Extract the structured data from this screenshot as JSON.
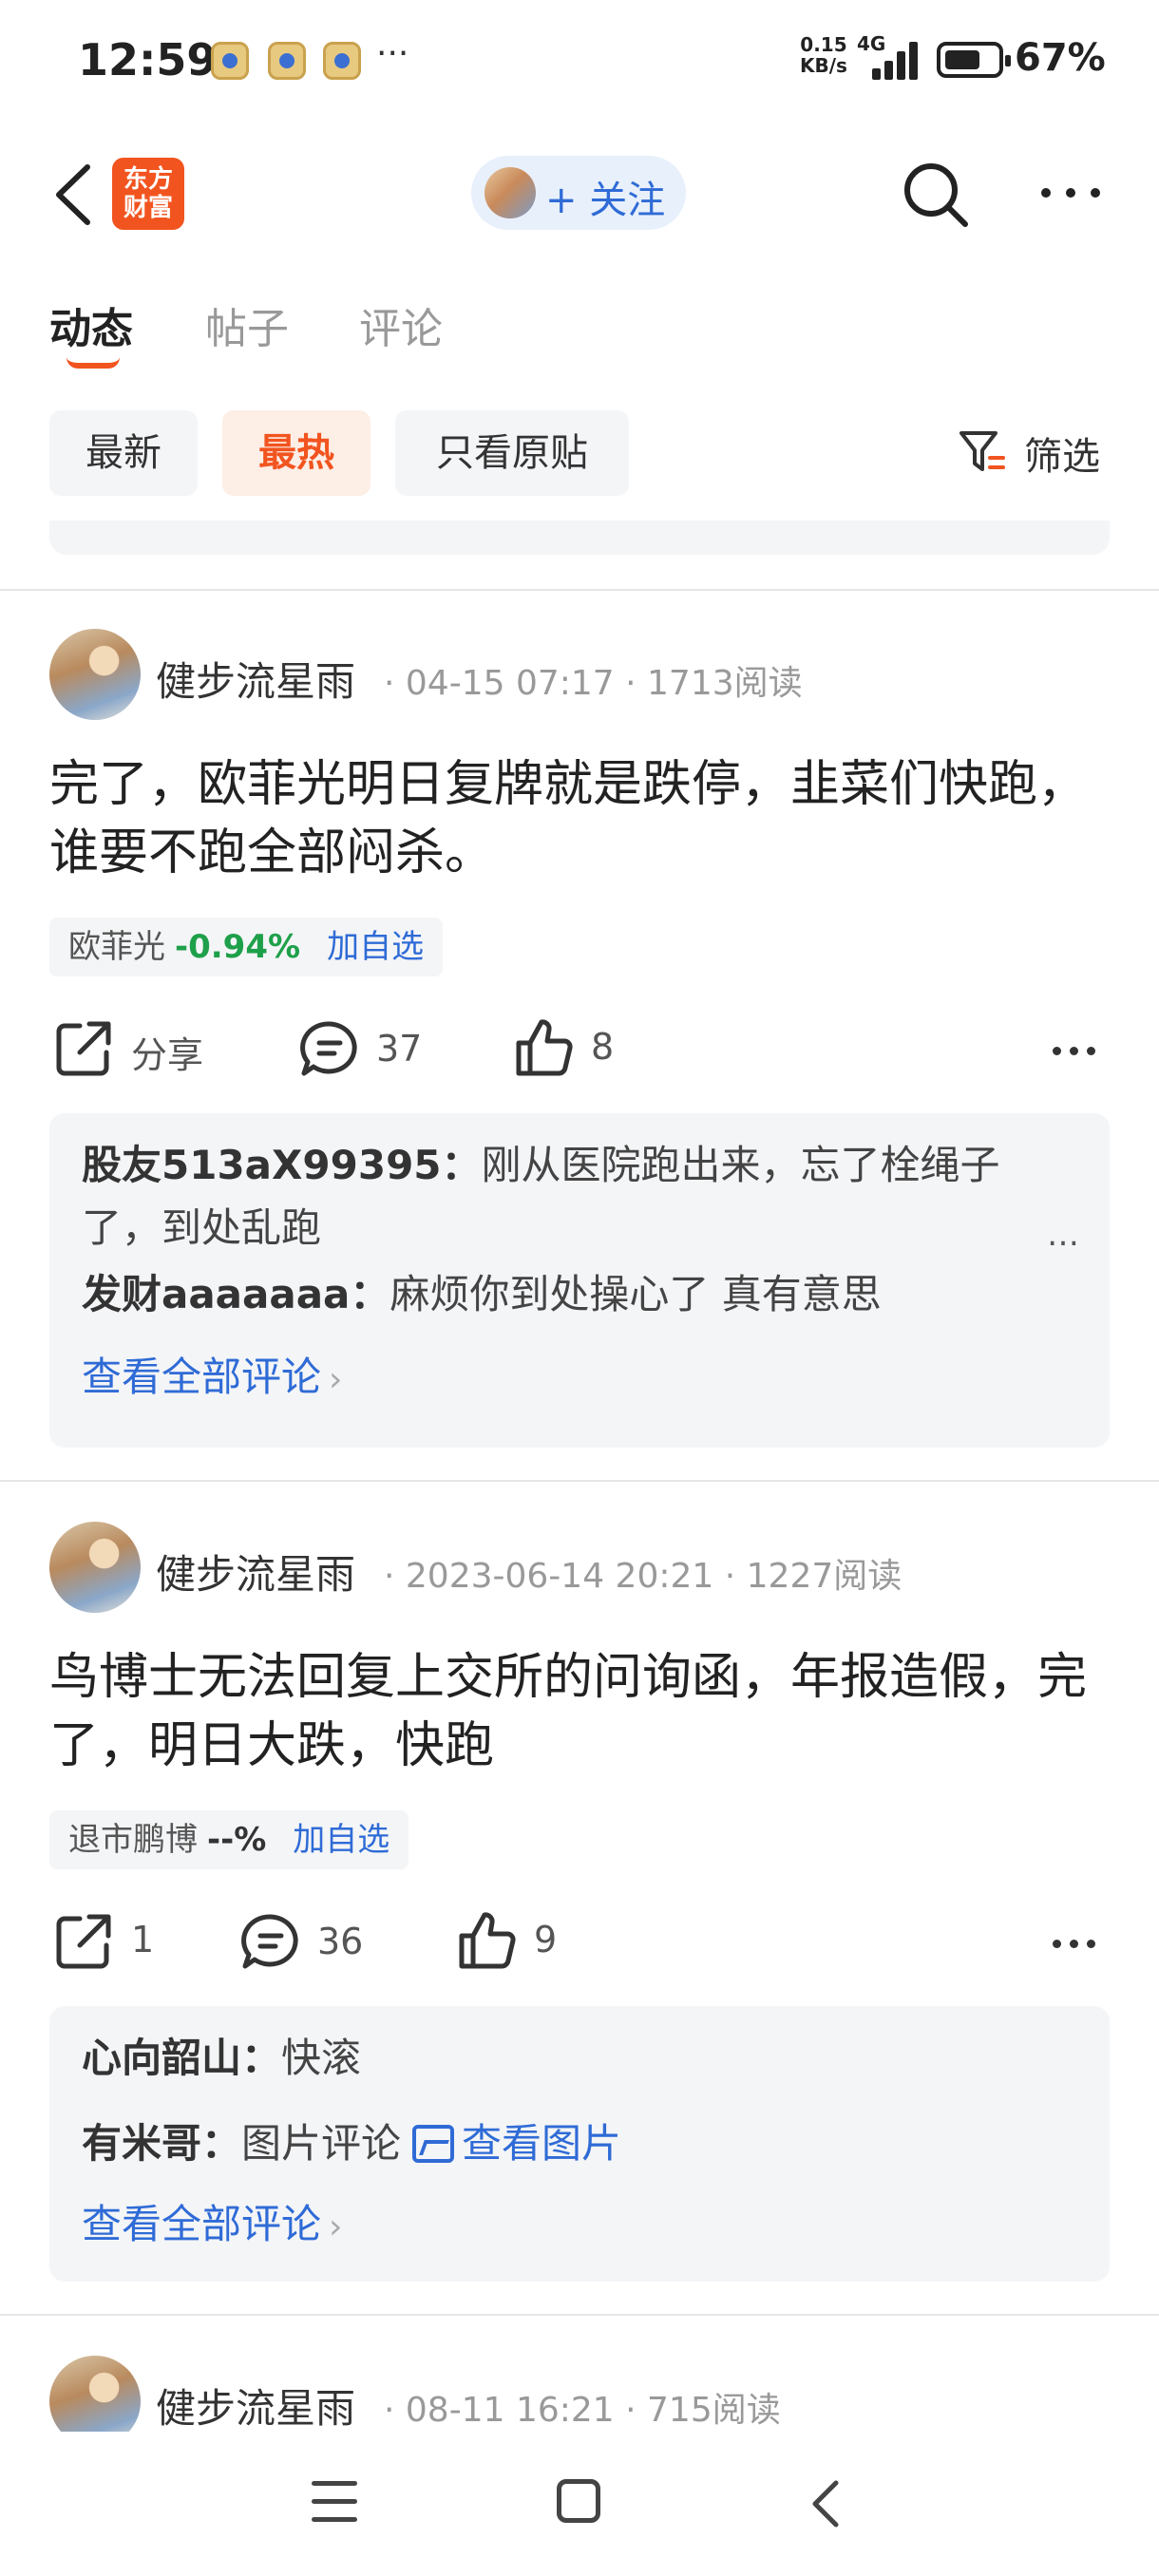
{
  "status_bar": {
    "time": "12:59",
    "more": "···",
    "net_speed_value": "0.15",
    "net_speed_unit": "KB/s",
    "network": "4G",
    "battery_pct": "67%",
    "battery_level": 0.67
  },
  "header": {
    "logo_line1": "东方",
    "logo_line2": "财富",
    "follow_label": "+ 关注"
  },
  "tabs": [
    {
      "label": "动态",
      "active": true
    },
    {
      "label": "帖子",
      "active": false
    },
    {
      "label": "评论",
      "active": false
    }
  ],
  "filters": [
    {
      "label": "最新",
      "active": false
    },
    {
      "label": "最热",
      "active": true
    },
    {
      "label": "只看原贴",
      "active": false
    }
  ],
  "filter_button": "筛选",
  "posts": [
    {
      "author": "健步流星雨",
      "date": "04-15 07:17",
      "reads": "1713阅读",
      "content": "完了，欧菲光明日复牌就是跌停，韭菜们快跑，谁要不跑全部闷杀。",
      "stock": {
        "name": "欧菲光",
        "change": "-0.94%",
        "add": "加自选"
      },
      "share": "分享",
      "comments_count": "37",
      "likes": "8",
      "comments": [
        {
          "user": "股友513aX99395",
          "text": "刚从医院跑出来，忘了栓绳子了，到处乱跑"
        },
        {
          "user": "发财aaaaaaa",
          "text": "麻烦你到处操心了 真有意思"
        }
      ],
      "more_comments_ellipsis": "…",
      "view_all": "查看全部评论"
    },
    {
      "author": "健步流星雨",
      "date": "2023-06-14 20:21",
      "reads": "1227阅读",
      "content": "鸟博士无法回复上交所的问询函，年报造假，完了，明日大跌，快跑",
      "stock": {
        "name": "退市鹏博",
        "change": "--%",
        "add": "加自选"
      },
      "share": "1",
      "comments_count": "36",
      "likes": "9",
      "comments": [
        {
          "user": "心向韶山",
          "text": "快滚"
        },
        {
          "user": "有米哥",
          "text": "图片评论",
          "link": "查看图片"
        }
      ],
      "view_all": "查看全部评论"
    },
    {
      "author": "健步流星雨",
      "date": "08-11 16:21",
      "reads": "715阅读"
    }
  ],
  "colors": {
    "brand": "#f2541f",
    "link": "#2f6bd6",
    "down": "#1ea04a"
  }
}
